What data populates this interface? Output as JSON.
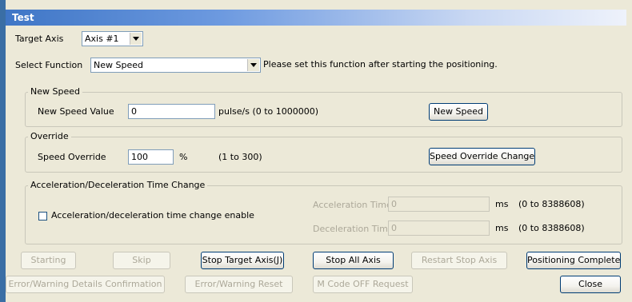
{
  "window": {
    "title": "Test"
  },
  "target_axis": {
    "label": "Target Axis",
    "value": "Axis #1"
  },
  "select_function": {
    "label": "Select Function",
    "value": "New Speed",
    "note": "Please set this function after starting the positioning."
  },
  "new_speed": {
    "group_title": "New Speed",
    "value_label": "New Speed Value",
    "value": "0",
    "unit_range": "pulse/s (0 to 1000000)",
    "button": "New Speed"
  },
  "override": {
    "group_title": "Override",
    "label": "Speed Override",
    "value": "100",
    "unit": "%",
    "range": "(1 to 300)",
    "button": "Speed Override Change"
  },
  "accel_decel": {
    "group_title": "Acceleration/Deceleration Time Change",
    "checkbox_label": "Acceleration/deceleration time change enable",
    "checked": false,
    "accel_label": "Acceleration Time",
    "accel_value": "0",
    "decel_label": "Deceleration Time",
    "decel_value": "0",
    "unit": "ms",
    "range": "(0 to 8388608)"
  },
  "buttons": {
    "starting": "Starting",
    "skip": "Skip",
    "stop_target_axis": "Stop Target Axis(J)",
    "stop_all_axis": "Stop All Axis",
    "restart_stop_axis": "Restart Stop Axis",
    "positioning_complete": "Positioning Complete",
    "error_details": "Error/Warning Details Confirmation",
    "error_reset": "Error/Warning Reset",
    "m_code_off": "M Code OFF Request",
    "close": "Close"
  }
}
